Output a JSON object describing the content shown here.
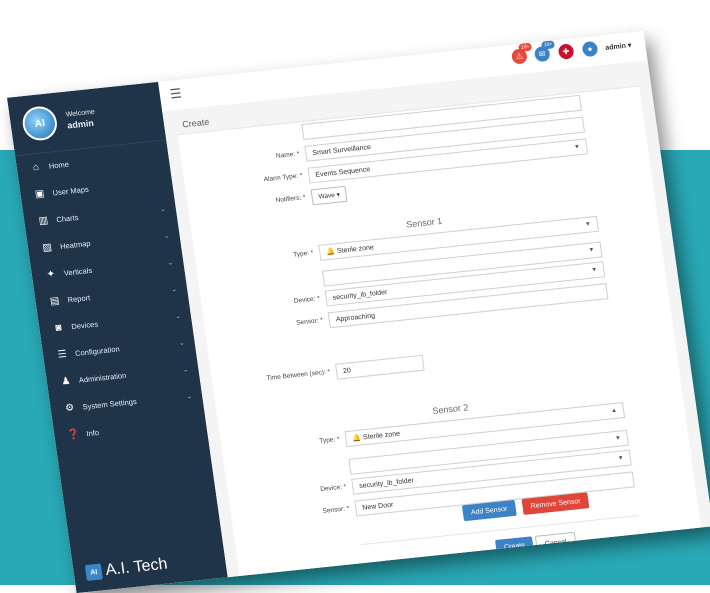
{
  "sidebar": {
    "welcome": "Welcome",
    "user": "admin",
    "avatar_text": "AI",
    "items": [
      {
        "label": "Home",
        "icon": "home-icon",
        "glyph": "⌂",
        "chevron": ""
      },
      {
        "label": "User Maps",
        "icon": "map-icon",
        "glyph": "▣",
        "chevron": ""
      },
      {
        "label": "Charts",
        "icon": "chart-icon",
        "glyph": "▥",
        "chevron": "⌄"
      },
      {
        "label": "Heatmap",
        "icon": "heatmap-icon",
        "glyph": "▨",
        "chevron": "⌄"
      },
      {
        "label": "Verticals",
        "icon": "verticals-icon",
        "glyph": "✦",
        "chevron": "⌄"
      },
      {
        "label": "Report",
        "icon": "report-icon",
        "glyph": "▤",
        "chevron": "⌄"
      },
      {
        "label": "Devices",
        "icon": "camera-icon",
        "glyph": "◙",
        "chevron": "⌄"
      },
      {
        "label": "Configuration",
        "icon": "configuration-icon",
        "glyph": "☰",
        "chevron": "⌄"
      },
      {
        "label": "Administration",
        "icon": "users-icon",
        "glyph": "♟",
        "chevron": "⌄"
      },
      {
        "label": "System Settings",
        "icon": "gears-icon",
        "glyph": "⚙",
        "chevron": "⌄"
      },
      {
        "label": "Info",
        "icon": "info-icon",
        "glyph": "❓",
        "chevron": ""
      }
    ],
    "logo_mark": "AI",
    "logo_text": "A.I. Tech"
  },
  "topbar": {
    "badge_1": "10+",
    "badge_2": "10+",
    "admin_label": "admin ▾",
    "colors": {
      "alert": "#e8493a",
      "chat": "#3b83c6",
      "flag": "#c8102e",
      "user": "#3b83c6"
    }
  },
  "form": {
    "title": "Create",
    "name_label": "Name: *",
    "name_value": "Smart Surveillance",
    "alarm_type_label": "Alarm Type: *",
    "alarm_type_value": "Events Sequence",
    "notifiers_label": "Notifiers: *",
    "notifiers_value": "Wave ▾",
    "sensor1": {
      "heading": "Sensor 1",
      "type_label": "Type: *",
      "type_value": "Sterile zone",
      "device_label": "Device: *",
      "device_value": "security_ib_folder",
      "sensor_label": "Sensor: *",
      "sensor_value": "Approaching"
    },
    "time_between_label": "Time Between (sec): *",
    "time_between_value": "20",
    "sensor2": {
      "heading": "Sensor 2",
      "type_label": "Type: *",
      "type_value": "Sterile zone",
      "device_label": "Device: *",
      "device_value": "security_ib_folder",
      "sensor_label": "Sensor: *",
      "sensor_value": "New Door"
    },
    "add_sensor": "Add Sensor",
    "remove_sensor": "Remove Sensor",
    "create": "Create",
    "cancel": "Cancel"
  },
  "colors": {
    "sidebar": "#1f3349",
    "background": "#29a9b6",
    "primary": "#3b83c6",
    "danger": "#e0453a"
  }
}
